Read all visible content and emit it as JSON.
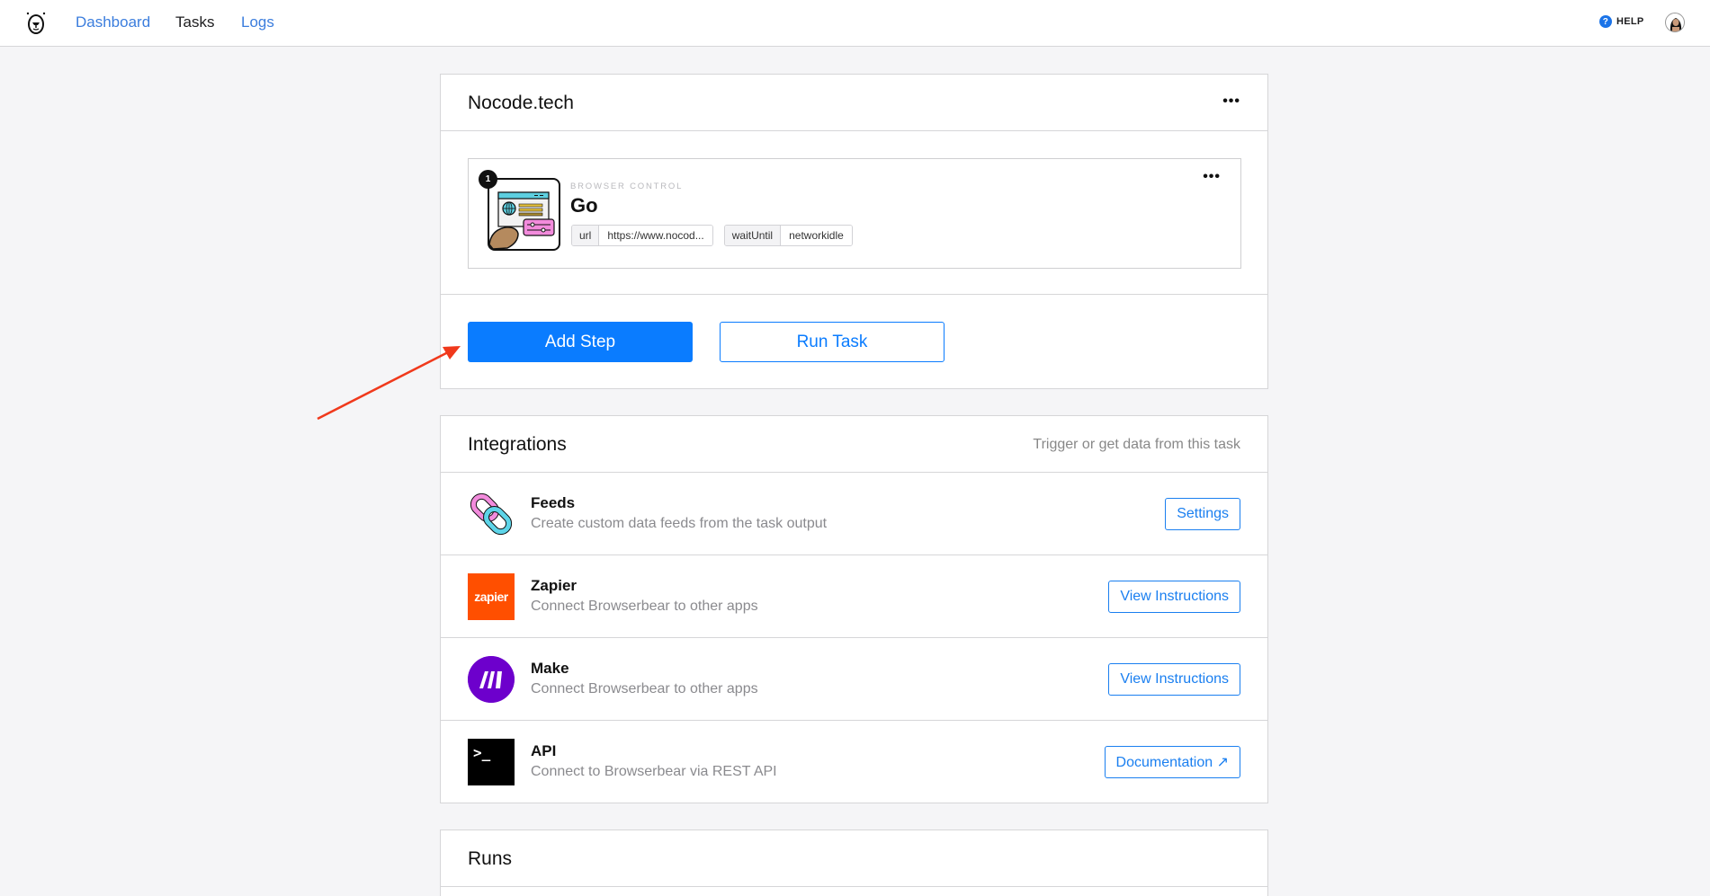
{
  "nav": {
    "logo": "browserbear-bear-logo",
    "links": [
      {
        "label": "Dashboard",
        "active": false
      },
      {
        "label": "Tasks",
        "active": true
      },
      {
        "label": "Logs",
        "active": false
      }
    ],
    "help_label": "HELP",
    "help_icon_glyph": "?"
  },
  "task": {
    "title": "Nocode.tech",
    "menu_glyph": "•••",
    "steps": [
      {
        "number": "1",
        "category": "BROWSER CONTROL",
        "title": "Go",
        "icon": "browser-window-icon",
        "params": [
          {
            "key": "url",
            "value": "https://www.nocod..."
          },
          {
            "key": "waitUntil",
            "value": "networkidle"
          }
        ]
      }
    ],
    "add_step_label": "Add Step",
    "run_task_label": "Run Task"
  },
  "integrations": {
    "title": "Integrations",
    "subtitle": "Trigger or get data from this task",
    "items": [
      {
        "name": "Feeds",
        "desc": "Create custom data feeds from the task output",
        "button": "Settings",
        "icon": "chain-link-icon"
      },
      {
        "name": "Zapier",
        "desc": "Connect Browserbear to other apps",
        "button": "View Instructions",
        "icon": "zapier-logo",
        "logo_text": "zapier"
      },
      {
        "name": "Make",
        "desc": "Connect Browserbear to other apps",
        "button": "View Instructions",
        "icon": "make-logo"
      },
      {
        "name": "API",
        "desc": "Connect to Browserbear via REST API",
        "button": "Documentation ↗",
        "icon": "terminal-icon",
        "logo_text": ">_"
      }
    ]
  },
  "runs": {
    "title": "Runs"
  },
  "colors": {
    "primary": "#0a7cff",
    "link": "#3b7ddd",
    "annotation_arrow": "#f0391c",
    "zapier": "#ff4f00",
    "make": "#6d00cc"
  }
}
